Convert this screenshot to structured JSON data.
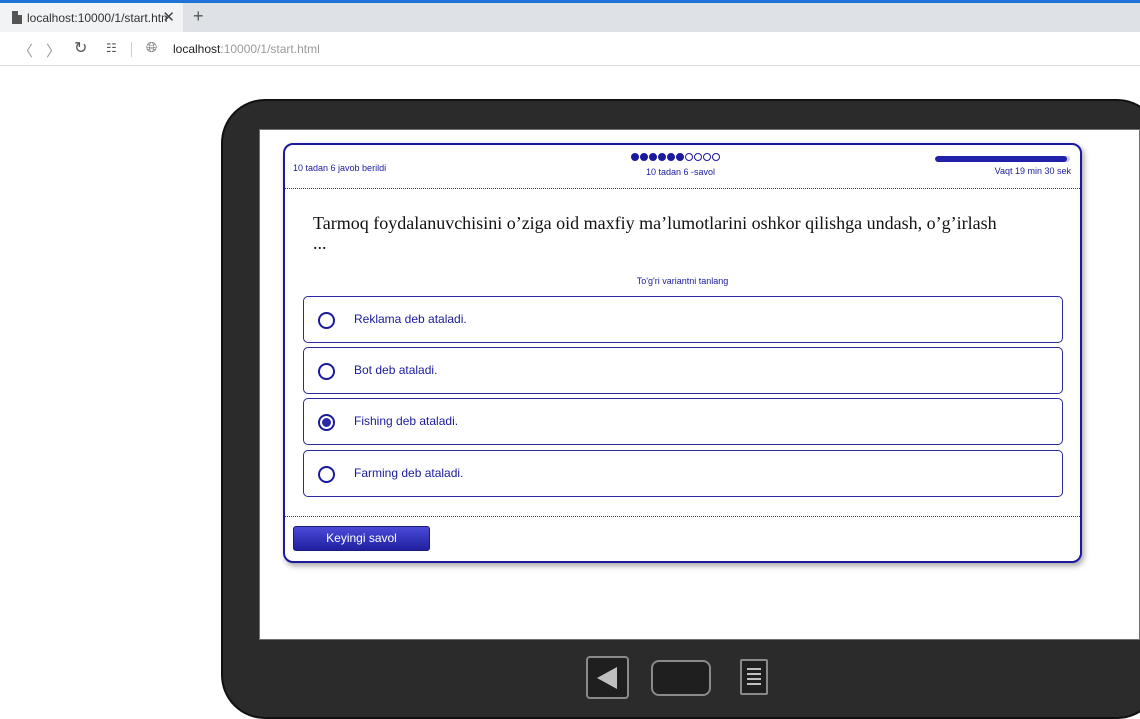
{
  "browser": {
    "tab_title": "localhost:10000/1/start.htm",
    "new_tab": "+",
    "close": "✕",
    "url_host": "localhost",
    "url_path": ":10000/1/start.html"
  },
  "quiz": {
    "answered_text": "10 tadan 6 javob berildi",
    "progress": {
      "total": 10,
      "current": 6
    },
    "counter_text": "10 tadan 6 -savol",
    "time_remaining_fraction": 0.98,
    "time_text": "Vaqt 19 min 30 sek",
    "question": "Tarmoq foydalanuvchisini o’ziga oid maxfiy ma’lumotlarini oshkor qilishga undash, o’g’irlash ...",
    "instruction": "To'g'ri variantni tanlang",
    "options": [
      {
        "label": "Reklama deb ataladi.",
        "selected": false
      },
      {
        "label": "Bot deb ataladi.",
        "selected": false
      },
      {
        "label": "Fishing deb ataladi.",
        "selected": true
      },
      {
        "label": "Farming deb ataladi.",
        "selected": false
      }
    ],
    "next_button": "Keyingi savol"
  },
  "colors": {
    "accent": "#1a1a9c",
    "button": "#2a2ab8",
    "browser_accent": "#1e73d6"
  }
}
